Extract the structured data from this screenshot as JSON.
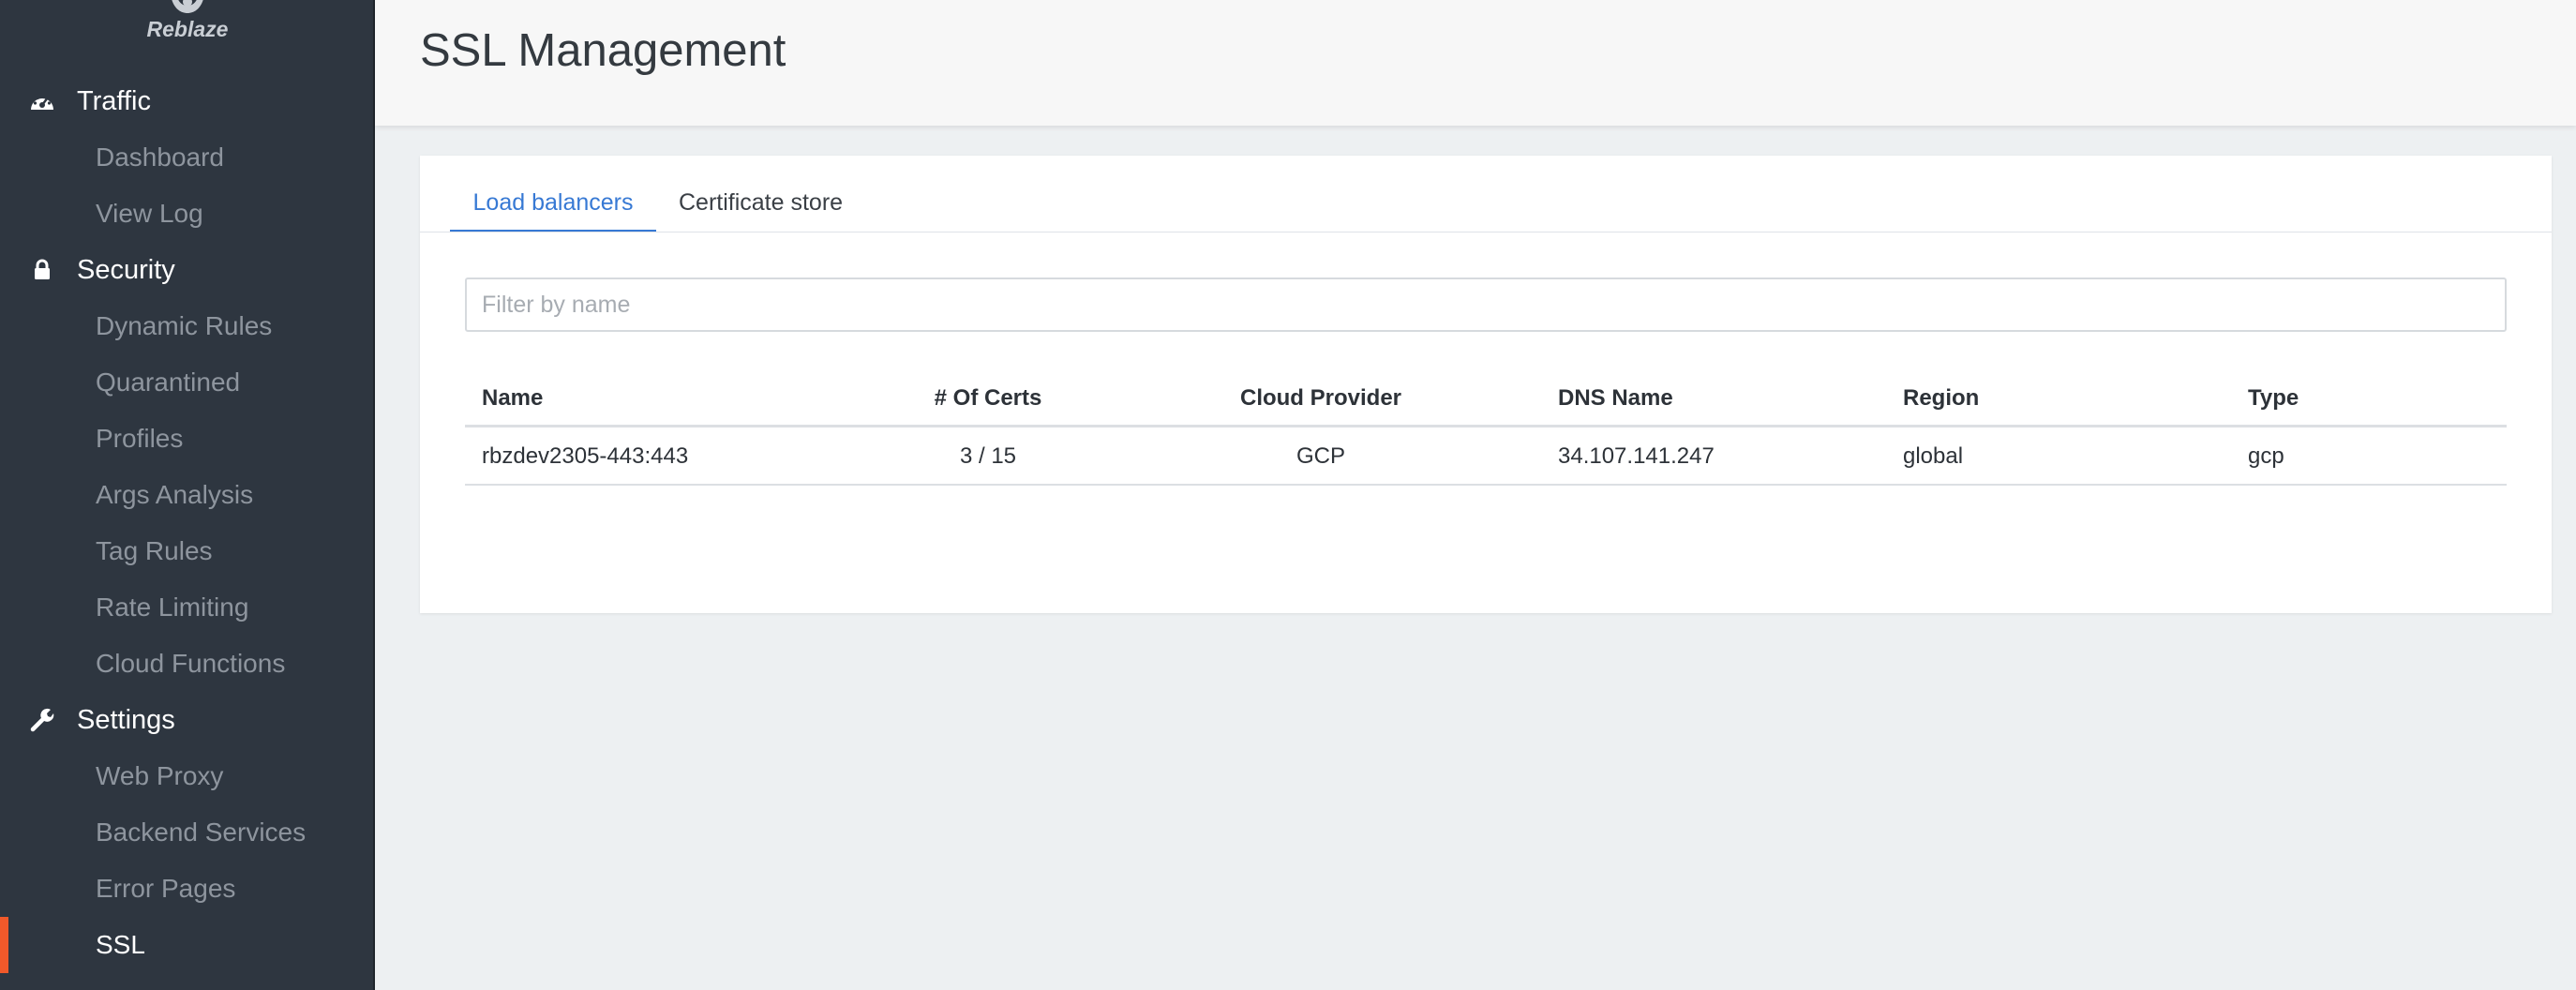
{
  "logo": {
    "text": "Reblaze"
  },
  "sidebar": {
    "sections": [
      {
        "label": "Traffic",
        "icon": "gauge-icon",
        "items": [
          "Dashboard",
          "View Log"
        ]
      },
      {
        "label": "Security",
        "icon": "lock-icon",
        "items": [
          "Dynamic Rules",
          "Quarantined",
          "Profiles",
          "Args Analysis",
          "Tag Rules",
          "Rate Limiting",
          "Cloud Functions"
        ]
      },
      {
        "label": "Settings",
        "icon": "wrench-icon",
        "items": [
          "Web Proxy",
          "Backend Services",
          "Error Pages",
          "SSL"
        ]
      }
    ],
    "active_item": "SSL",
    "accent_color": "#f0592a"
  },
  "header": {
    "title": "SSL Management"
  },
  "tabs": [
    {
      "label": "Load balancers",
      "active": true
    },
    {
      "label": "Certificate store",
      "active": false
    }
  ],
  "filter": {
    "placeholder": "Filter by name",
    "value": ""
  },
  "table": {
    "columns": [
      "Name",
      "# Of Certs",
      "Cloud Provider",
      "DNS Name",
      "Region",
      "Type"
    ],
    "rows": [
      [
        "rbzdev2305-443:443",
        "3 / 15",
        "GCP",
        "34.107.141.247",
        "global",
        "gcp"
      ]
    ]
  },
  "colors": {
    "link": "#3779d4",
    "sidebar_bg": "#2e3640"
  }
}
